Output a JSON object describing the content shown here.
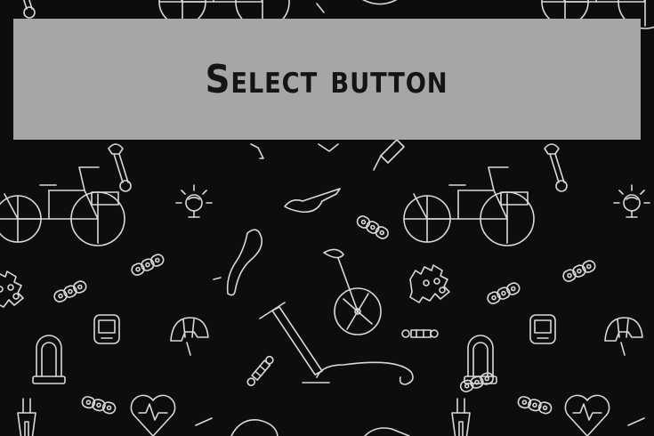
{
  "banner": {
    "label": "Select button"
  },
  "background": {
    "color": "#0d0d0d",
    "line_color": "#d9d9d9",
    "icons": [
      "bicycle-icon",
      "wrench-icon",
      "bell-icon",
      "sunglasses-icon",
      "chain-icon",
      "saddle-icon",
      "unicycle-icon",
      "chainring-icon",
      "helmet-icon",
      "bike-computer-icon",
      "u-lock-icon",
      "pump-icon",
      "heart-rate-icon",
      "oil-bottle-icon",
      "fork-icon",
      "axle-bolt-icon"
    ]
  },
  "colors": {
    "banner_bg": "#a6a6a6",
    "banner_text": "#141414"
  }
}
